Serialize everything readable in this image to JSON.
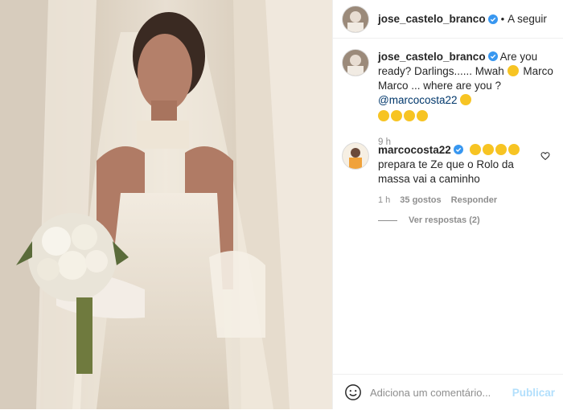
{
  "post": {
    "image_alt": "bride in white dress holding bouquet",
    "author": "jose_castelo_branco",
    "follow_label": "A seguir",
    "more_label": "•••"
  },
  "caption": {
    "author": "jose_castelo_branco",
    "text_1": "Are you ready? Darlings...... Mwah",
    "text_2": "Marco Marco ... where are you ?",
    "mention": "@marcocosta22",
    "time": "9 h"
  },
  "comment": {
    "author": "marcocosta22",
    "text": "prepara te Ze que o Rolo da massa vai a caminho",
    "time": "1 h",
    "likes": "35 gostos",
    "reply_label": "Responder"
  },
  "replies": {
    "label": "Ver respostas (2)"
  },
  "footer": {
    "placeholder": "Adiciona um comentário...",
    "post_label": "Publicar"
  },
  "colors": {
    "verified": "#3897f0",
    "link": "#00376b",
    "publish_disabled": "#b2dffc",
    "emoji": "#f7c423"
  }
}
